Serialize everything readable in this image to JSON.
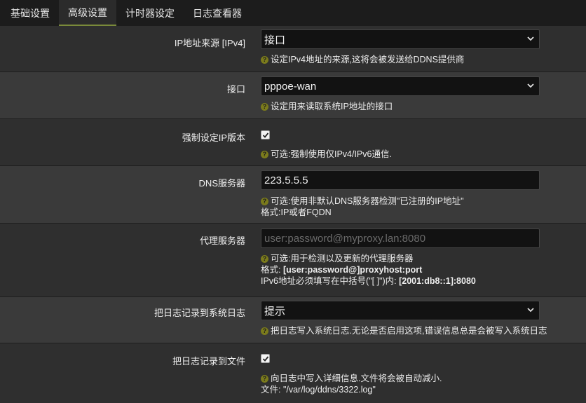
{
  "tabs": [
    {
      "label": "基础设置"
    },
    {
      "label": "高级设置"
    },
    {
      "label": "计时器设定"
    },
    {
      "label": "日志查看器"
    }
  ],
  "ip_source": {
    "label": "IP地址来源 [IPv4]",
    "value": "接口",
    "help": "设定IPv4地址的来源,这将会被发送给DDNS提供商"
  },
  "interface": {
    "label": "接口",
    "value": "pppoe-wan",
    "help": "设定用来读取系统IP地址的接口"
  },
  "force_ip": {
    "label": "强制设定IP版本",
    "checked": true,
    "help": "可选:强制使用仅IPv4/IPv6通信."
  },
  "dns_server": {
    "label": "DNS服务器",
    "value": "223.5.5.5",
    "help_line1": "可选:使用非默认DNS服务器检测\"已注册的IP地址\"",
    "help_line2": "格式:IP或者FQDN"
  },
  "proxy": {
    "label": "代理服务器",
    "placeholder": "user:password@myproxy.lan:8080",
    "help_line1": "可选:用于检测以及更新的代理服务器",
    "help_line2_prefix": "格式: ",
    "help_line2_bold": "[user:password@]proxyhost:port",
    "help_line3_prefix": "IPv6地址必须填写在中括号(\"[ ]\")内: ",
    "help_line3_bold": "[2001:db8::1]:8080"
  },
  "syslog": {
    "label": "把日志记录到系统日志",
    "value": "提示",
    "help": "把日志写入系统日志.无论是否启用这项,错误信息总是会被写入系统日志"
  },
  "logfile": {
    "label": "把日志记录到文件",
    "checked": true,
    "help_line1": "向日志中写入详细信息.文件将会被自动减小.",
    "help_line2": "文件: \"/var/log/ddns/3322.log\""
  },
  "colors": {
    "accent": "#7a8a3a",
    "help_icon": "#7b7b1c"
  },
  "icons": {
    "select_arrow": "chevron-down-icon",
    "help": "question-circle-icon",
    "check": "check-icon"
  }
}
